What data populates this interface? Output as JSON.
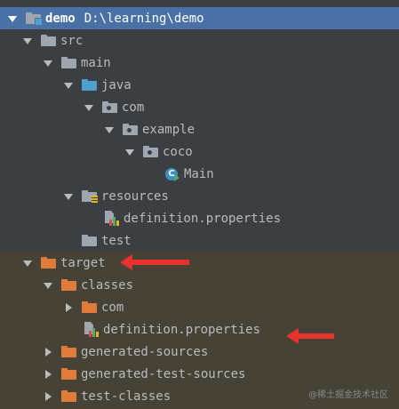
{
  "project": {
    "name": "demo",
    "path": "D:\\learning\\demo"
  },
  "tree": {
    "src": "src",
    "main": "main",
    "java": "java",
    "com": "com",
    "example": "example",
    "coco": "coco",
    "main_class": "Main",
    "main_class_icon_letter": "C",
    "resources": "resources",
    "definition_properties": "definition.properties",
    "test": "test",
    "target": "target",
    "classes": "classes",
    "classes_com": "com",
    "classes_definition_properties": "definition.properties",
    "generated_sources": "generated-sources",
    "generated_test_sources": "generated-test-sources",
    "test_classes": "test-classes"
  },
  "watermark": "@稀土掘金技术社区",
  "colors": {
    "background": "#3c3f41",
    "selection": "#4a71a6",
    "excluded_band": "#464236",
    "annotation_arrow": "#e8322e",
    "excluded_folder": "#e07b3a",
    "source_folder": "#4f9fcf"
  },
  "icons": {
    "module": "module-folder-icon",
    "folder": "folder-icon",
    "source_root": "source-root-folder-icon",
    "package": "package-icon",
    "resources_root": "resources-root-folder-icon",
    "excluded_folder": "excluded-folder-icon",
    "properties_file": "properties-file-icon",
    "java_class": "java-class-icon"
  }
}
